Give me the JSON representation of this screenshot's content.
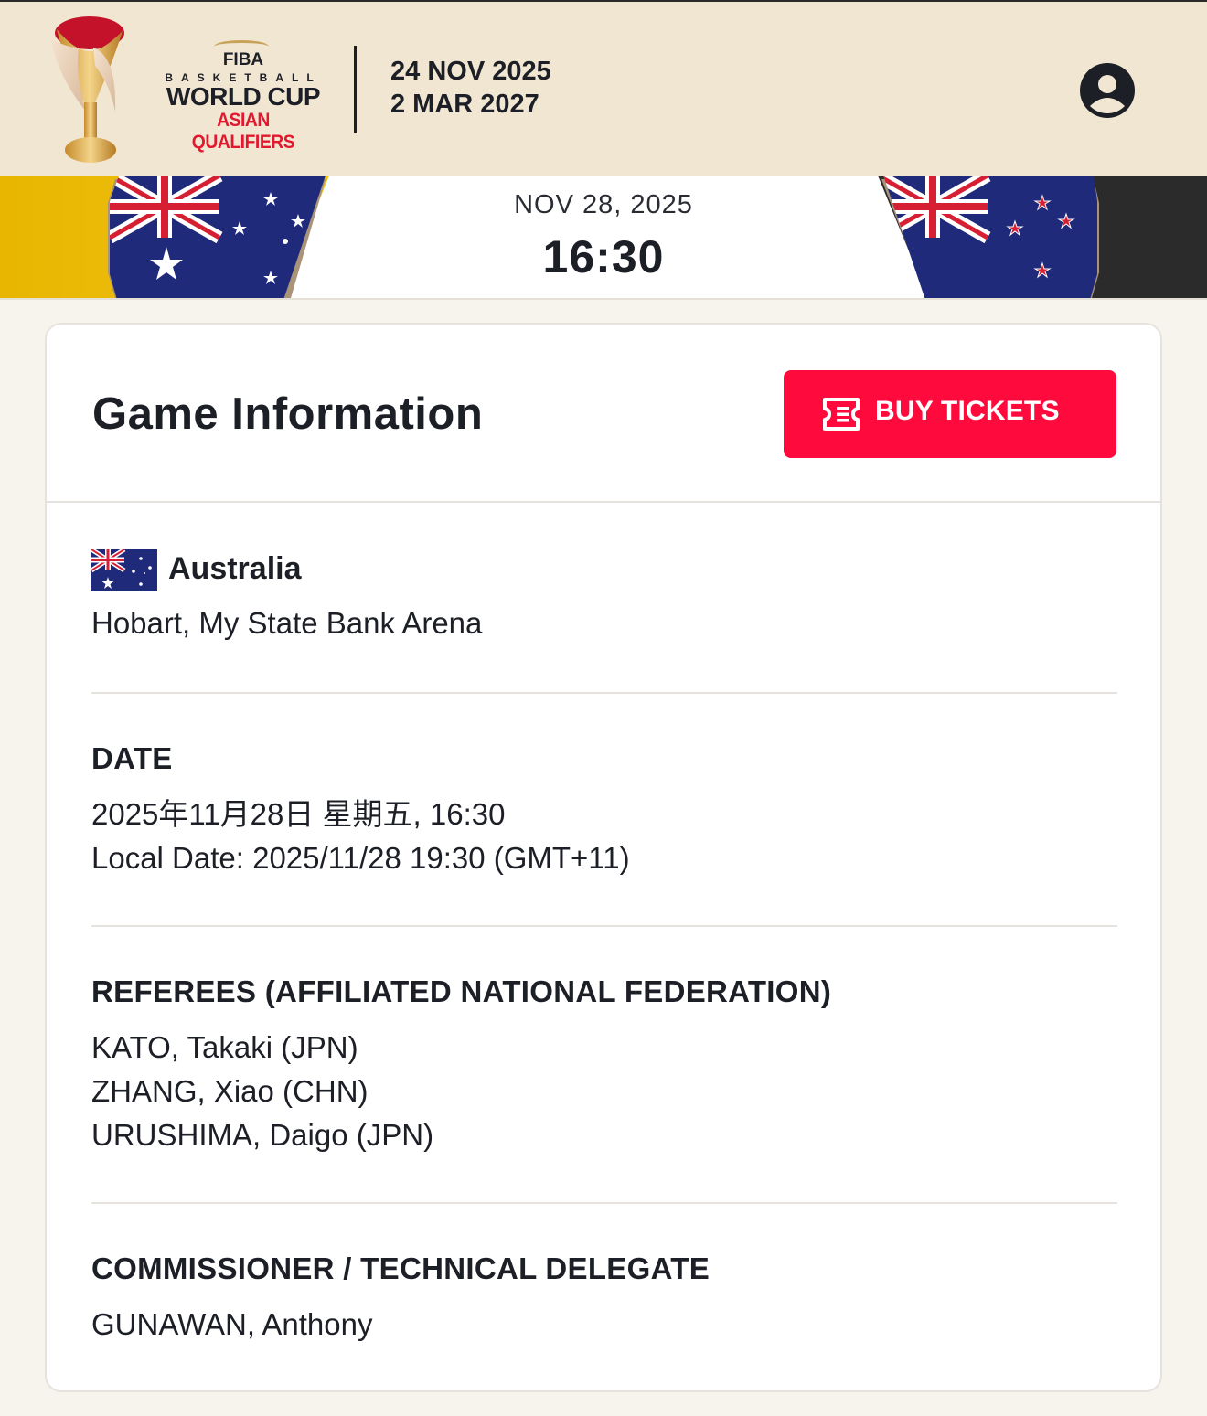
{
  "header": {
    "logo": {
      "fiba": "FIBA",
      "basketball": "BASKETBALL",
      "world_cup": "WORLD CUP",
      "asian_qualifiers": "ASIAN QUALIFIERS"
    },
    "date_start": "24 NOV 2025",
    "date_end": "2 MAR 2027",
    "user_icon": "user-circle-icon"
  },
  "matchup": {
    "home_team_flag": "australia-flag",
    "away_team_flag": "new-zealand-flag",
    "date": "NOV 28, 2025",
    "time": "16:30",
    "colors": {
      "home": "#e8b600",
      "away": "#2a2a2a"
    }
  },
  "game_info": {
    "title": "Game Information",
    "buy_button": {
      "label": "BUY TICKETS",
      "icon": "ticket-icon",
      "color": "#ff0a3c"
    },
    "venue": {
      "country": "Australia",
      "place": "Hobart, My State Bank Arena"
    },
    "date_section": {
      "label": "DATE",
      "lines": [
        "2025年11月28日 星期五, 16:30",
        "Local Date: 2025/11/28 19:30 (GMT+11)"
      ]
    },
    "referees": {
      "label": "REFEREES (AFFILIATED NATIONAL FEDERATION)",
      "names": [
        "KATO, Takaki (JPN)",
        "ZHANG, Xiao (CHN)",
        "URUSHIMA, Daigo (JPN)"
      ]
    },
    "commissioner": {
      "label": "COMMISSIONER / TECHNICAL DELEGATE",
      "names": [
        "GUNAWAN, Anthony"
      ]
    }
  }
}
